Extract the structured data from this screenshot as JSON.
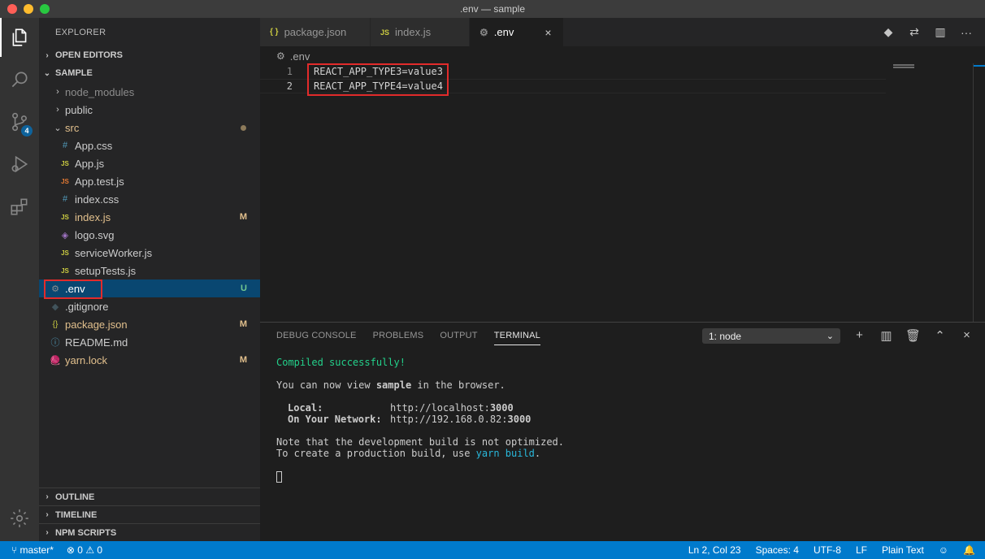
{
  "window": {
    "title": ".env — sample"
  },
  "explorer": {
    "title": "EXPLORER",
    "open_editors": "OPEN EDITORS",
    "root": "SAMPLE",
    "items": [
      {
        "name": "node_modules",
        "status": ""
      },
      {
        "name": "public",
        "status": ""
      },
      {
        "name": "src",
        "status": ""
      },
      {
        "name": "App.css",
        "status": ""
      },
      {
        "name": "App.js",
        "status": ""
      },
      {
        "name": "App.test.js",
        "status": ""
      },
      {
        "name": "index.css",
        "status": ""
      },
      {
        "name": "index.js",
        "status": "M"
      },
      {
        "name": "logo.svg",
        "status": ""
      },
      {
        "name": "serviceWorker.js",
        "status": ""
      },
      {
        "name": "setupTests.js",
        "status": ""
      },
      {
        "name": ".env",
        "status": "U"
      },
      {
        "name": ".gitignore",
        "status": ""
      },
      {
        "name": "package.json",
        "status": "M"
      },
      {
        "name": "README.md",
        "status": ""
      },
      {
        "name": "yarn.lock",
        "status": "M"
      }
    ],
    "sections": [
      "OUTLINE",
      "TIMELINE",
      "NPM SCRIPTS"
    ]
  },
  "activity": {
    "scm_badge": "4"
  },
  "tabs": [
    {
      "label": "package.json",
      "icon": "{ }"
    },
    {
      "label": "index.js",
      "icon": "JS"
    },
    {
      "label": ".env",
      "icon": "gear-icon"
    }
  ],
  "breadcrumb": ".env",
  "editor": {
    "lines": [
      {
        "num": "1",
        "text": "REACT_APP_TYPE3=value3"
      },
      {
        "num": "2",
        "text": "REACT_APP_TYPE4=value4"
      }
    ]
  },
  "panel": {
    "tabs": [
      "DEBUG CONSOLE",
      "PROBLEMS",
      "OUTPUT",
      "TERMINAL"
    ],
    "terminal_select": "1: node",
    "output": {
      "compiled": "Compiled successfully!",
      "view_pre": "You can now view ",
      "view_app": "sample",
      "view_post": " in the browser.",
      "local_label": "Local:",
      "local_url_pre": "http://localhost:",
      "local_port": "3000",
      "network_label": "On Your Network:",
      "network_url_pre": "http://192.168.0.82:",
      "network_port": "3000",
      "note": "Note that the development build is not optimized.",
      "prod_pre": "To create a production build, use ",
      "prod_cmd": "yarn build",
      "prod_post": "."
    }
  },
  "statusbar": {
    "branch": "master*",
    "errors": "0",
    "warnings": "0",
    "position": "Ln 2, Col 23",
    "spaces": "Spaces: 4",
    "encoding": "UTF-8",
    "eol": "LF",
    "language": "Plain Text"
  },
  "colors": {
    "accent": "#007acc",
    "modified": "#e2c08d",
    "untracked": "#73c991",
    "highlight_border": "#e22b2b"
  }
}
